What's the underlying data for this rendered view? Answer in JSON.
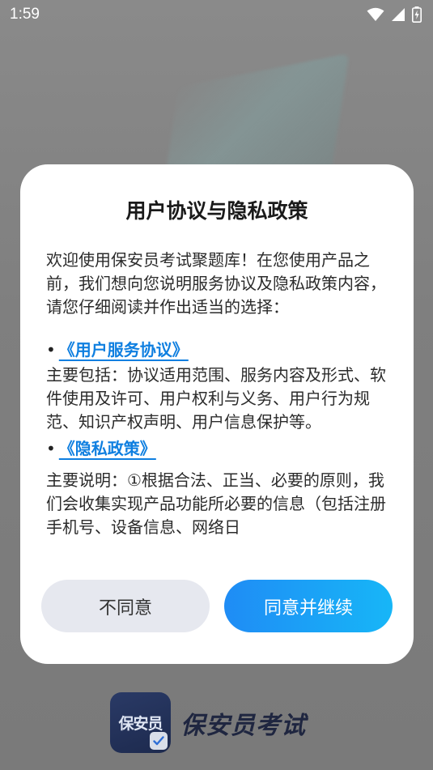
{
  "status_bar": {
    "time": "1:59",
    "icons": [
      "wifi-icon",
      "signal-icon",
      "battery-charging-icon"
    ]
  },
  "dialog": {
    "title": "用户协议与隐私政策",
    "intro": "欢迎使用保安员考试聚题库！在您使用产品之前，我们想向您说明服务协议及隐私政策内容，请您仔细阅读并作出适当的选择：",
    "bullet": "•",
    "sections": [
      {
        "link": "《用户服务协议》",
        "text": "主要包括：协议适用范围、服务内容及形式、软件使用及许可、用户权利与义务、用户行为规范、知识产权声明、用户信息保护等。"
      },
      {
        "link": "《隐私政策》",
        "text": "主要说明：①根据合法、正当、必要的原则，我们会收集实现产品功能所必要的信息（包括注册手机号、设备信息、网络日"
      }
    ],
    "decline_label": "不同意",
    "accept_label": "同意并继续",
    "accent_color": "#0f7fe0"
  },
  "brand": {
    "icon_text": "保安员",
    "name": "保安员考试"
  }
}
